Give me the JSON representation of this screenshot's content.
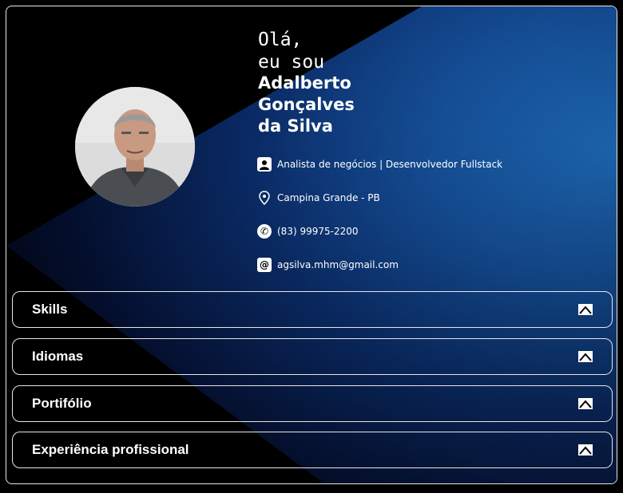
{
  "profile": {
    "greeting_line1": "Olá,",
    "greeting_line2": "eu sou",
    "name_line1": "Adalberto",
    "name_line2": "Gonçalves",
    "name_line3": "da Silva"
  },
  "info": [
    {
      "icon": "user-icon",
      "text": "Analista de negócios | Desenvolvedor Fullstack"
    },
    {
      "icon": "location-pin-icon",
      "text": "Campina Grande - PB"
    },
    {
      "icon": "phone-icon",
      "text": "(83) 99975-2200"
    },
    {
      "icon": "at-sign-icon",
      "text": "agsilva.mhm@gmail.com"
    }
  ],
  "sections": [
    {
      "label": "Skills"
    },
    {
      "label": "Idiomas"
    },
    {
      "label": "Portifólio"
    },
    {
      "label": "Experiência profissional"
    }
  ],
  "colors": {
    "background": "#000000",
    "accent_blue": "#1f6fc0",
    "border": "#e6e6e6"
  }
}
